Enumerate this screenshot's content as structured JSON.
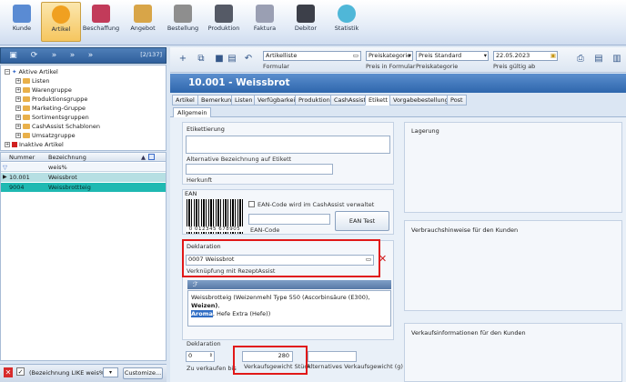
{
  "ribbon": [
    {
      "label": "Kunde",
      "icon": "customer-icon",
      "color": "#5a8bd3"
    },
    {
      "label": "Artikel",
      "icon": "article-icon",
      "color": "#f0a020",
      "active": true
    },
    {
      "label": "Beschaffung",
      "icon": "basket-icon",
      "color": "#c23b5a"
    },
    {
      "label": "Angebot",
      "icon": "handshake-icon",
      "color": "#d8a548"
    },
    {
      "label": "Bestellung",
      "icon": "order-icon",
      "color": "#8e8e8e"
    },
    {
      "label": "Produktion",
      "icon": "factory-icon",
      "color": "#555a66"
    },
    {
      "label": "Faktura",
      "icon": "invoice-icon",
      "color": "#9a9fb3"
    },
    {
      "label": "Debitor",
      "icon": "debtor-icon",
      "color": "#3c3f49"
    },
    {
      "label": "Statistik",
      "icon": "chart-icon",
      "color": "#4fb7d8"
    }
  ],
  "left": {
    "counter": "[2/137]",
    "tree": [
      {
        "label": "Aktive Artikel",
        "level": 0
      },
      {
        "label": "Listen",
        "level": 1
      },
      {
        "label": "Warengruppe",
        "level": 1
      },
      {
        "label": "Produktionsgruppe",
        "level": 1
      },
      {
        "label": "Marketing-Gruppe",
        "level": 1
      },
      {
        "label": "Sortimentsgruppen",
        "level": 1
      },
      {
        "label": "CashAssist Schablonen",
        "level": 1
      },
      {
        "label": "Umsatzgruppe",
        "level": 1
      },
      {
        "label": "Inaktive Artikel",
        "level": 0
      }
    ],
    "grid": {
      "col_number": "Nummer",
      "col_name": "Bezeichnung",
      "filter": "weis%",
      "rows": [
        {
          "number": "10.001",
          "name": "Weissbrot"
        },
        {
          "number": "9004",
          "name": "Weissbrottteig"
        }
      ]
    },
    "filter_text": "(Bezeichnung LIKE weis%",
    "customize": "Customize..."
  },
  "toolbar": {
    "artikelliste": "Artikelliste",
    "formular": "Formular",
    "preiskategorie": "Preiskategorie",
    "preis_in_formular": "Preis in Formular",
    "preis_standard": "Preis Standard",
    "preiskategorie_cap": "Preiskategorie",
    "date": "22.05.2023",
    "preis_gueltig": "Preis gültig ab"
  },
  "title": "10.001 - Weissbrot",
  "tabs": [
    "Artikel",
    "Bemerkung",
    "Listen",
    "Verfügbarkeit",
    "Produktion",
    "CashAssist",
    "Etikett",
    "Vorgabebestellung",
    "Post"
  ],
  "active_tab": "Etikett",
  "subtab": "Allgemein",
  "form": {
    "etikettierung": "Etikettierung",
    "alt_bez": "Alternative Bezeichnung auf Etikett",
    "herkunft": "Herkunft",
    "lagerung": "Lagerung",
    "ean": "EAN",
    "ean_check": "EAN-Code wird im CashAssist verwaltet",
    "ean_code": "EAN-Code",
    "ean_test": "EAN Test",
    "barcode_digits": "0 012345 678905",
    "verbrauch": "Verbrauchshinweise für den Kunden",
    "deklaration": "Deklaration",
    "dekl_value": "0007  Weissbrot",
    "verknuepfung": "Verknüpfung mit RezeptAssist",
    "ingredients_pre": "Weissbrotteig (Weizenmehl Type 550 (Ascorbinsäure (E300), ",
    "ingredients_bold": "Weizen)",
    "ingredients_comma": ",",
    "ingredients_hl": "Aroma",
    "ingredients_post": ", Hefe Extra (Hefe))",
    "deklaration2": "Deklaration",
    "dekl2_value": "0",
    "zu_verkaufen": "Zu verkaufen bis",
    "weight_value": "280",
    "verkaufsgewicht": "Verkaufsgewicht Stück",
    "alt_gewicht": "Alternatives Verkaufsgewicht (g)",
    "verkaufsinfo": "Verkaufsinformationen für den Kunden"
  },
  "colors": {
    "accent": "#2e66ad",
    "highlight": "#e11818",
    "selected_row": "#1fb9b2"
  }
}
